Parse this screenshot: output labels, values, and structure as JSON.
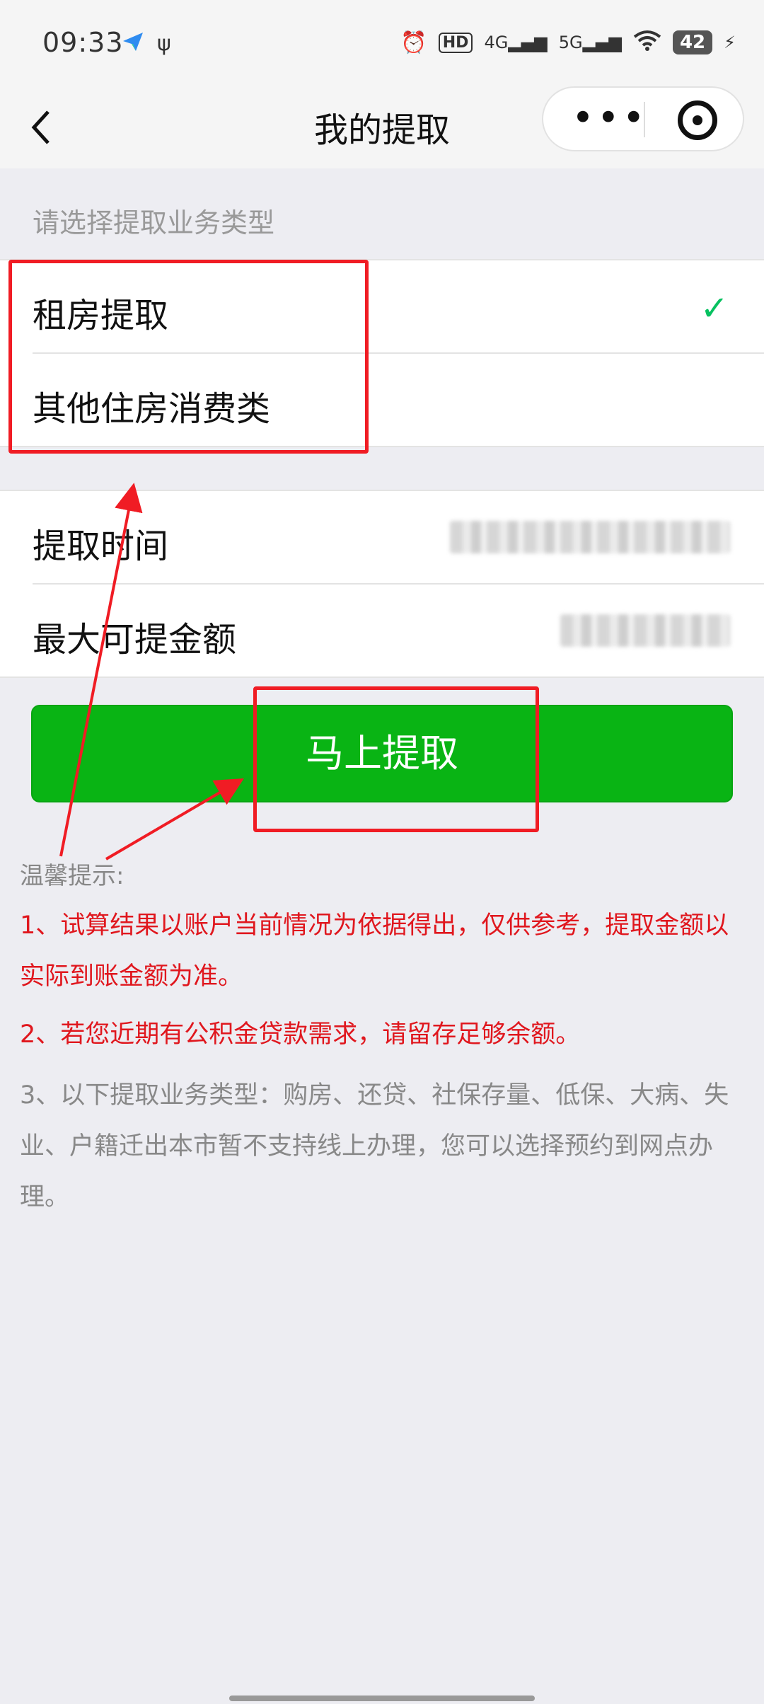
{
  "status_bar": {
    "time": "09:33",
    "network1": "4G",
    "network2": "5G",
    "hd_badge": "HD",
    "battery": "42",
    "icons": [
      "app-notify-icon",
      "usb-icon",
      "alarm-icon",
      "hd-icon",
      "signal-icon",
      "wifi-icon",
      "battery-icon",
      "charging-icon"
    ]
  },
  "nav": {
    "back_icon": "chevron-left-icon",
    "title": "我的提取",
    "more_label": "•••",
    "target_icon": "target-icon"
  },
  "section": {
    "title": "请选择提取业务类型"
  },
  "options": [
    {
      "label": "租房提取",
      "selected": true
    },
    {
      "label": "其他住房消费类",
      "selected": false
    }
  ],
  "check_mark": "✓",
  "info": [
    {
      "label": "提取时间"
    },
    {
      "label": "最大可提金额"
    }
  ],
  "action": {
    "label": "马上提取"
  },
  "tips": {
    "title": "温馨提示:",
    "items": [
      {
        "text": "1、试算结果以账户当前情况为依据得出，仅供参考，提取金额以实际到账金额为准。",
        "color": "#E0171E"
      },
      {
        "text": "2、若您近期有公积金贷款需求，请留存足够余额。",
        "color": "#E0171E"
      },
      {
        "text": "3、以下提取业务类型：购房、还贷、社保存量、低保、大病、失业、户籍迁出本市暂不支持线上办理，您可以选择预约到网点办理。",
        "color": "#888888"
      }
    ]
  },
  "colors": {
    "accent_green": "#09B414",
    "annotation_red": "#F01C24"
  }
}
